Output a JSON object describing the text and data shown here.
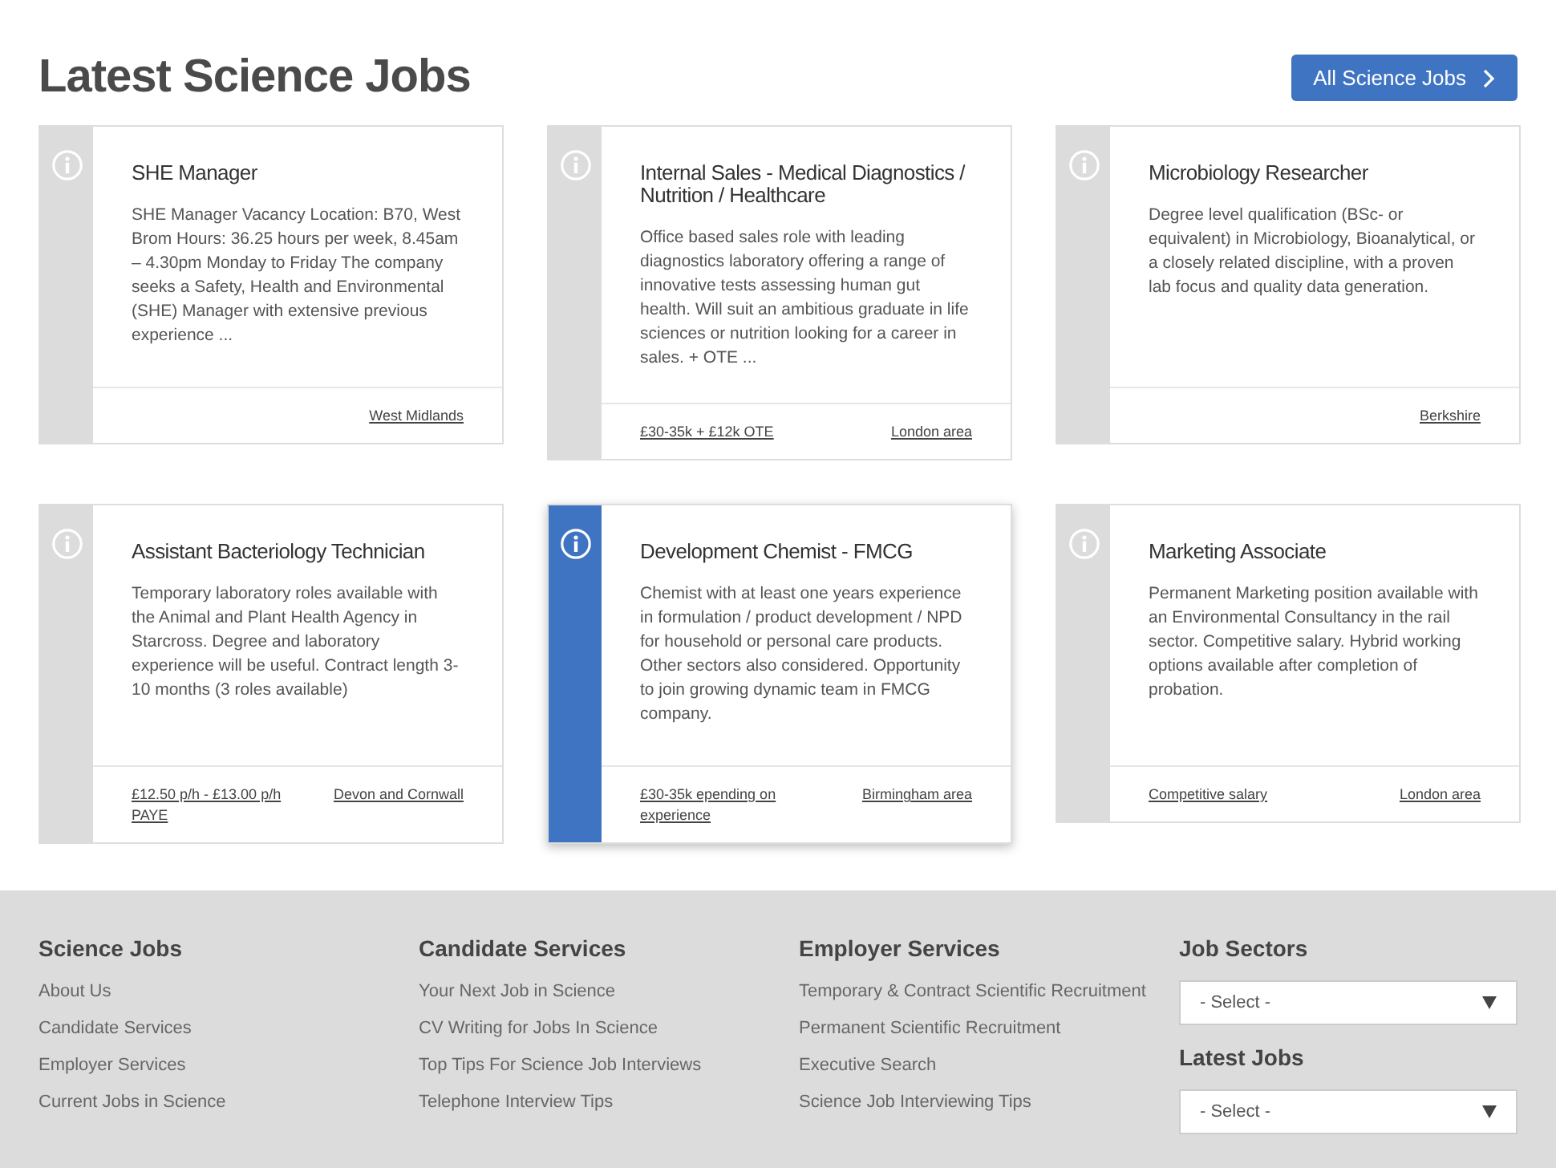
{
  "header": {
    "title": "Latest Science Jobs",
    "button": "All Science Jobs"
  },
  "jobs": [
    {
      "title": "SHE Manager",
      "description": "SHE Manager Vacancy Location: B70, West Brom Hours: 36.25 hours per week, 8.45am – 4.30pm Monday to Friday  The company seeks a Safety, Health and Environmental (SHE) Manager with extensive previous experience ...",
      "location": "West Midlands",
      "selected": false
    },
    {
      "title": "Internal Sales - Medical Diagnostics / Nutrition / Healthcare",
      "description": "Office based sales role with leading diagnostics laboratory offering a range of innovative tests assessing human gut health. Will suit an ambitious graduate in life sciences or nutrition looking for a career in sales. + OTE ...",
      "salary": "£30-35k + £12k OTE",
      "location": "London area",
      "selected": false
    },
    {
      "title": "Microbiology Researcher",
      "description": "Degree level qualification (BSc- or equivalent) in Microbiology, Bioanalytical, or a closely related discipline, with a proven lab focus and quality data generation.",
      "location": "Berkshire",
      "selected": false
    },
    {
      "title": "Assistant Bacteriology Technician",
      "description": "Temporary laboratory roles available with the Animal and Plant Health Agency in Starcross. Degree and laboratory experience will be useful. Contract length 3-10 months (3 roles available)",
      "salary": "£12.50 p/h - £13.00 p/h PAYE",
      "location": "Devon and Cornwall",
      "selected": false
    },
    {
      "title": "Development Chemist - FMCG",
      "description": "Chemist with at least one years experience in formulation / product development / NPD for household or personal care products. Other sectors also considered. Opportunity to join growing dynamic team in FMCG company.",
      "salary": "£30-35k epending on experience",
      "location": "Birmingham area",
      "selected": true
    },
    {
      "title": "Marketing Associate",
      "description": "Permanent Marketing position available with an Environmental Consultancy in the rail sector. Competitive salary. Hybrid working options available after completion of probation.",
      "salary": "Competitive salary",
      "location": "London area",
      "selected": false
    }
  ],
  "footer": {
    "columns": [
      {
        "heading": "Science Jobs",
        "links": [
          "About Us",
          "Candidate Services",
          "Employer Services",
          "Current Jobs in Science"
        ]
      },
      {
        "heading": "Candidate Services",
        "links": [
          "Your Next Job in Science",
          "CV Writing for Jobs In Science",
          "Top Tips For Science Job Interviews",
          "Telephone Interview Tips"
        ]
      },
      {
        "heading": "Employer Services",
        "links": [
          "Temporary & Contract Scientific Recruitment",
          "Permanent Scientific Recruitment",
          "Executive Search",
          "Science Job Interviewing Tips"
        ]
      }
    ],
    "selects": [
      {
        "heading": "Job Sectors",
        "value": "- Select -"
      },
      {
        "heading": "Latest Jobs",
        "value": "- Select -"
      }
    ]
  }
}
